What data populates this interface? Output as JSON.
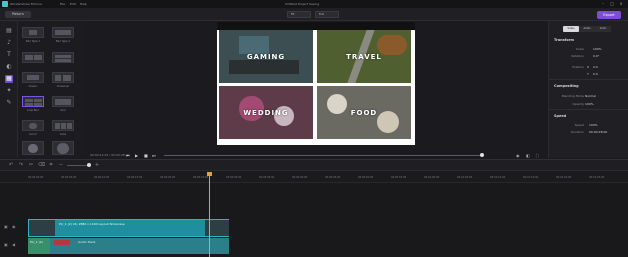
{
  "titlebar": {
    "app_name": "Wondershare Filmora",
    "menus": [
      "File",
      "Edit",
      "Help"
    ],
    "project": "Untitled Project Saving"
  },
  "toolbar": {
    "back_label": "Return",
    "quality": "Fit",
    "resolution": "Full",
    "export_label": "Export"
  },
  "templates": [
    {
      "label": "Blur Type 1"
    },
    {
      "label": "Blur Type 2"
    },
    {
      "label": ""
    },
    {
      "label": ""
    },
    {
      "label": "Classic"
    },
    {
      "label": "Crossover"
    },
    {
      "label": "Loop Blur"
    },
    {
      "label": "Grid"
    },
    {
      "label": "Grid 2"
    },
    {
      "label": "Cube"
    },
    {
      "label": "Film"
    },
    {
      "label": "Vortex"
    }
  ],
  "preview": {
    "tiles": [
      {
        "label": "GAMING",
        "color": "#3d4e52"
      },
      {
        "label": "TRAVEL",
        "color": "#4f5f2f"
      },
      {
        "label": "WEDDING",
        "color": "#5e3b48"
      },
      {
        "label": "FOOD",
        "color": "#6a6a63"
      }
    ],
    "timecode": "00:00:12:25 / 00:00:28:00"
  },
  "properties": {
    "tabs": [
      "Video",
      "Audio",
      "Color"
    ],
    "transform_title": "Transform",
    "scale_label": "Scale",
    "scale_value": "100%",
    "rotation_label": "Rotation",
    "rotation_value": "0.0°",
    "position_label": "Position",
    "x_label": "X",
    "x_value": "0.0",
    "y_label": "Y",
    "y_value": "0.0",
    "compositing_title": "Compositing",
    "blend_label": "Blending Mode",
    "blend_value": "Normal",
    "opacity_label": "Opacity",
    "opacity_value": "100%",
    "speed_title": "Speed",
    "speed_label": "Speed",
    "speed_value": "100%",
    "duration_label": "Duration",
    "duration_value": "00:00:28:00"
  },
  "timeline": {
    "ticks": [
      "00:00:00:00",
      "00:00:05:00",
      "00:00:10:00",
      "00:00:15:00",
      "00:00:20:00",
      "00:00:25:00",
      "00:00:30:00",
      "00:00:35:00",
      "00:00:40:00",
      "00:00:45:00",
      "00:00:50:00",
      "00:00:55:00",
      "00:01:00:00",
      "00:01:05:00",
      "00:01:10:00",
      "00:01:15:00",
      "00:01:20:00",
      "00:01:25:00"
    ],
    "video_clip": "Pic_1 (2) 4K, 2880 x 1440 Layout Showcase",
    "audio_clip": "Audio Track",
    "audio_badge": "Pic_1 (2)"
  }
}
